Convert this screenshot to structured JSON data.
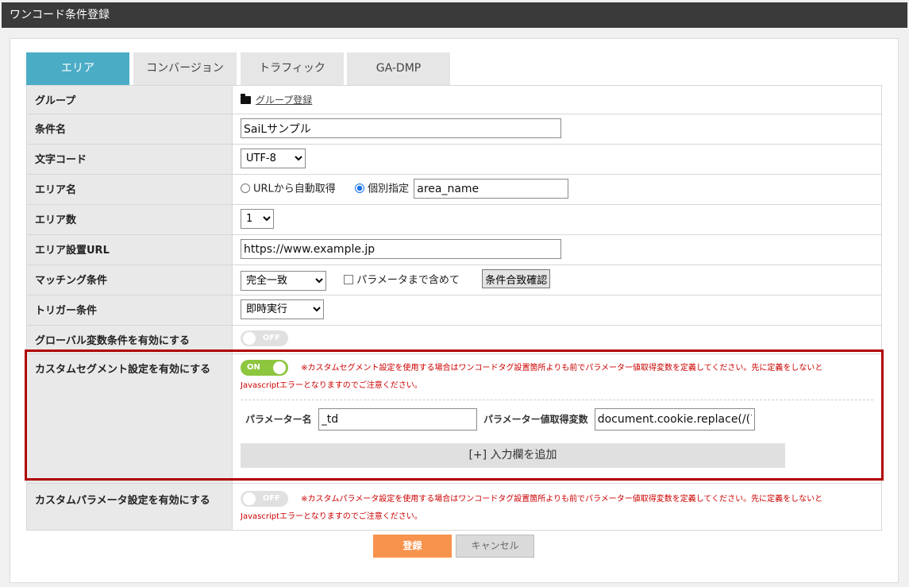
{
  "window": {
    "title": "ワンコード条件登録"
  },
  "tabs": [
    {
      "label": "エリア",
      "active": true
    },
    {
      "label": "コンバージョン",
      "active": false
    },
    {
      "label": "トラフィック",
      "active": false
    },
    {
      "label": "GA-DMP",
      "active": false
    }
  ],
  "form": {
    "group": {
      "label": "グループ",
      "link": "グループ登録"
    },
    "condition_name": {
      "label": "条件名",
      "value": "SaiLサンプル"
    },
    "charset": {
      "label": "文字コード",
      "value": "UTF-8"
    },
    "area_name": {
      "label": "エリア名",
      "option_auto": "URLから自動取得",
      "option_manual": "個別指定",
      "selected": "個別指定",
      "value": "area_name"
    },
    "area_count": {
      "label": "エリア数",
      "value": "1"
    },
    "area_url": {
      "label": "エリア設置URL",
      "value": "https://www.example.jp"
    },
    "matching": {
      "label": "マッチング条件",
      "value": "完全一致",
      "include_params": "パラメータまで含めて",
      "include_params_checked": false,
      "check_button": "条件合致確認"
    },
    "trigger": {
      "label": "トリガー条件",
      "value": "即時実行"
    },
    "global_var": {
      "label": "グローバル変数条件を有効にする",
      "toggle": "OFF"
    },
    "custom_segment": {
      "label": "カスタムセグメント設定を有効にする",
      "toggle": "ON",
      "note_line1": "※カスタムセグメント設定を使用する場合はワンコードタグ設置箇所よりも前でパラメーター値取得変数を定義してください。先に定義をしないと",
      "note_line2": "Javascriptエラーとなりますのでご注意ください。",
      "param_name_label": "パラメーター名",
      "param_name_value": "_td",
      "param_var_label": "パラメーター値取得変数",
      "param_var_value": "document.cookie.replace(/(?:",
      "add_button": "[+] 入力欄を追加"
    },
    "custom_param": {
      "label": "カスタムパラメータ設定を有効にする",
      "toggle": "OFF",
      "note_line1": "※カスタムパラメータ設定を使用する場合はワンコードタグ設置箇所よりも前でパラメーター値取得変数を定義してください。先に定義をしないと",
      "note_line2": "Javascriptエラーとなりますのでご注意ください。"
    }
  },
  "actions": {
    "submit": "登録",
    "cancel": "キャンセル"
  },
  "colors": {
    "tab_active": "#4bacc6",
    "toggle_on": "#8dc63f",
    "submit": "#f7934c",
    "highlight": "#b00000",
    "note": "#cc0000"
  }
}
